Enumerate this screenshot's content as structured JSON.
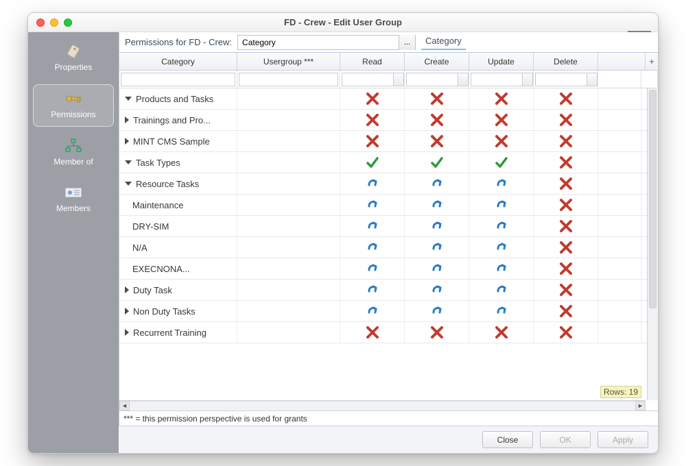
{
  "window": {
    "title": "FD - Crew - Edit User Group"
  },
  "sidebar": {
    "items": [
      {
        "label": "Properties"
      },
      {
        "label": "Permissions"
      },
      {
        "label": "Member of"
      },
      {
        "label": "Members"
      }
    ]
  },
  "toolbar": {
    "label": "Permissions for FD - Crew:",
    "category_value": "Category",
    "picker_btn": "...",
    "tab_label": "Category"
  },
  "columns": {
    "category": "Category",
    "usergroup": "Usergroup ***",
    "read": "Read",
    "create": "Create",
    "update": "Update",
    "delete": "Delete",
    "plus": "+"
  },
  "rows": [
    {
      "indent": 0,
      "toggle": "down",
      "label": "Products and Tasks",
      "perms": [
        "deny",
        "deny",
        "deny",
        "deny"
      ]
    },
    {
      "indent": 1,
      "toggle": "right",
      "label": "Trainings and Pro...",
      "perms": [
        "deny",
        "deny",
        "deny",
        "deny"
      ]
    },
    {
      "indent": 1,
      "toggle": "right",
      "label": "MINT CMS Sample",
      "perms": [
        "deny",
        "deny",
        "deny",
        "deny"
      ]
    },
    {
      "indent": 1,
      "toggle": "down",
      "label": "Task Types",
      "perms": [
        "allow",
        "allow",
        "allow",
        "deny"
      ]
    },
    {
      "indent": 2,
      "toggle": "down",
      "label": "Resource Tasks",
      "perms": [
        "inherit",
        "inherit",
        "inherit",
        "deny"
      ]
    },
    {
      "indent": 3,
      "toggle": "none",
      "label": "Maintenance",
      "perms": [
        "inherit",
        "inherit",
        "inherit",
        "deny"
      ]
    },
    {
      "indent": 3,
      "toggle": "none",
      "label": "DRY-SIM",
      "perms": [
        "inherit",
        "inherit",
        "inherit",
        "deny"
      ]
    },
    {
      "indent": 3,
      "toggle": "none",
      "label": "N/A",
      "perms": [
        "inherit",
        "inherit",
        "inherit",
        "deny"
      ]
    },
    {
      "indent": 3,
      "toggle": "none",
      "label": "EXECNONA...",
      "perms": [
        "inherit",
        "inherit",
        "inherit",
        "deny"
      ]
    },
    {
      "indent": 2,
      "toggle": "right",
      "label": "Duty Task",
      "perms": [
        "inherit",
        "inherit",
        "inherit",
        "deny"
      ]
    },
    {
      "indent": 2,
      "toggle": "right",
      "label": "Non Duty Tasks",
      "perms": [
        "inherit",
        "inherit",
        "inherit",
        "deny"
      ]
    },
    {
      "indent": 1,
      "toggle": "right",
      "label": "Recurrent Training",
      "perms": [
        "deny",
        "deny",
        "deny",
        "deny"
      ]
    }
  ],
  "footnote": "*** = this permission perspective is used for grants",
  "rows_badge": "Rows: 19",
  "buttons": {
    "close": "Close",
    "ok": "OK",
    "apply": "Apply"
  }
}
